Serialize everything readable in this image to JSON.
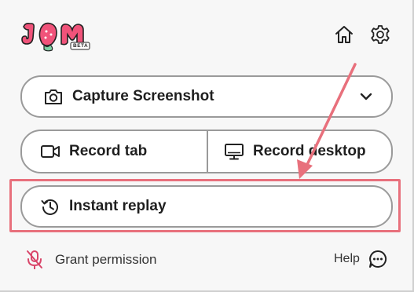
{
  "app": {
    "logo_text": "JAM",
    "logo_badge": "BETA"
  },
  "header": {
    "home_icon": "home-icon",
    "settings_icon": "gear-icon"
  },
  "actions": {
    "capture_label": "Capture Screenshot",
    "capture_icon": "camera-icon",
    "capture_dropdown_icon": "chevron-down-icon",
    "record_tab_label": "Record tab",
    "record_tab_icon": "video-camera-icon",
    "record_desktop_label": "Record desktop",
    "record_desktop_icon": "monitor-icon",
    "instant_replay_label": "Instant replay",
    "instant_replay_icon": "history-icon"
  },
  "footer": {
    "grant_permission_label": "Grant permission",
    "grant_permission_icon": "microphone-off-icon",
    "help_label": "Help",
    "help_icon": "chat-bubble-icon"
  },
  "colors": {
    "highlight": "#e8707c",
    "logo_pink": "#f0537a",
    "border": "#9a9a9a",
    "mic_off": "#d9466a"
  }
}
